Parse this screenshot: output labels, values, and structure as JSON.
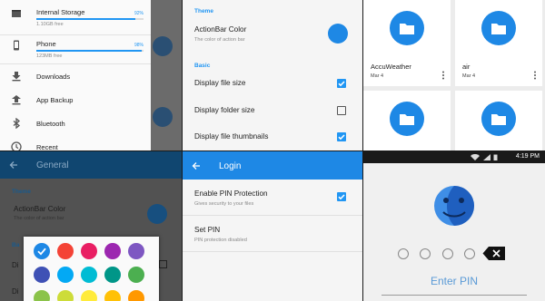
{
  "drawer": {
    "storages": [
      {
        "label": "Internal Storage",
        "free": "1.10GB free",
        "percent_text": "92%",
        "used_fraction": 0.92
      },
      {
        "label": "Phone",
        "free": "123MB free",
        "percent_text": "98%",
        "used_fraction": 0.98
      }
    ],
    "items": [
      {
        "label": "Downloads",
        "icon": "download-icon"
      },
      {
        "label": "App Backup",
        "icon": "backup-icon"
      },
      {
        "label": "Bluetooth",
        "icon": "bluetooth-icon"
      },
      {
        "label": "Recent",
        "icon": "clock-icon"
      }
    ]
  },
  "settings": {
    "theme_header": "Theme",
    "actionbar_title": "ActionBar Color",
    "actionbar_sub": "The color of action bar",
    "basic_header": "Basic",
    "options": [
      {
        "label": "Display file size",
        "checked": true
      },
      {
        "label": "Display folder size",
        "checked": false
      },
      {
        "label": "Display file thumbnails",
        "checked": true
      }
    ],
    "accent": "#1e88e5"
  },
  "grid": {
    "folders": [
      {
        "name": "AccuWeather",
        "date": "Mar 4"
      },
      {
        "name": "air",
        "date": "Mar 4"
      }
    ]
  },
  "general": {
    "title": "General",
    "theme_header": "Theme",
    "actionbar_title": "ActionBar Color",
    "actionbar_sub": "The color of action bar",
    "basic_header": "Ba",
    "row_prefix": "Di",
    "swatch_colors": [
      "#1e88e5",
      "#f44336",
      "#e91e63",
      "#9c27b0",
      "#7e57c2",
      "#3f51b5",
      "#03a9f4",
      "#00bcd4",
      "#009688",
      "#4caf50",
      "#8bc34a",
      "#cddc39",
      "#ffeb3b",
      "#ffc107",
      "#ff9800"
    ],
    "selected_index": 0
  },
  "login": {
    "title": "Login",
    "pin_protection_title": "Enable PIN Protection",
    "pin_protection_sub": "Gives security to your files",
    "pin_protection_checked": true,
    "set_pin_title": "Set PIN",
    "set_pin_sub": "PIN protection disabled"
  },
  "pin": {
    "time": "4:19 PM",
    "enter_label": "Enter PIN",
    "digits": 4
  }
}
